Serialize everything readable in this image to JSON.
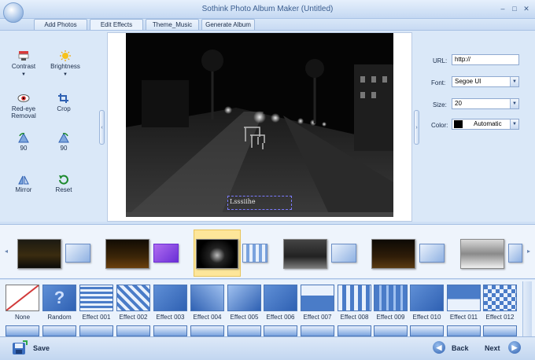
{
  "window": {
    "title": "Sothink Photo Album Maker (Untitled)",
    "minimize": "–",
    "maximize": "□",
    "close": "✕"
  },
  "tabs": [
    {
      "label": "Add Photos"
    },
    {
      "label": "Edit Effects"
    },
    {
      "label": "Theme_Music"
    },
    {
      "label": "Generate Album"
    }
  ],
  "active_tab": "Edit Effects",
  "tools": [
    {
      "label": "Contrast",
      "icon": "contrast-icon"
    },
    {
      "label": "Brightness",
      "icon": "brightness-icon"
    },
    {
      "label": "Red-eye Removal",
      "icon": "red-eye-icon"
    },
    {
      "label": "Crop",
      "icon": "crop-icon"
    },
    {
      "label": "90",
      "icon": "rotate-left-icon"
    },
    {
      "label": "90",
      "icon": "rotate-right-icon"
    },
    {
      "label": "Mirror",
      "icon": "mirror-icon"
    },
    {
      "label": "Reset",
      "icon": "reset-icon"
    }
  ],
  "preview": {
    "caption": "Lsssiihe"
  },
  "properties": {
    "url_label": "URL:",
    "url_value": "http://",
    "font_label": "Font:",
    "font_value": "Segoe UI",
    "size_label": "Size:",
    "size_value": "20",
    "color_label": "Color:",
    "color_value": "Automatic",
    "color_swatch": "#000000"
  },
  "effects": [
    {
      "label": "None"
    },
    {
      "label": "Random"
    },
    {
      "label": "Effect 001"
    },
    {
      "label": "Effect 002"
    },
    {
      "label": "Effect 003"
    },
    {
      "label": "Effect 004"
    },
    {
      "label": "Effect 005"
    },
    {
      "label": "Effect 006"
    },
    {
      "label": "Effect 007"
    },
    {
      "label": "Effect 008"
    },
    {
      "label": "Effect 009"
    },
    {
      "label": "Effect 010"
    },
    {
      "label": "Effect 011"
    },
    {
      "label": "Effect 012"
    }
  ],
  "footer": {
    "save_label": "Save",
    "back_label": "Back",
    "next_label": "Next"
  },
  "colors": {
    "accent": "#2f61b3",
    "selected_slot": "#fde69a",
    "background": "#cfe0f5"
  }
}
